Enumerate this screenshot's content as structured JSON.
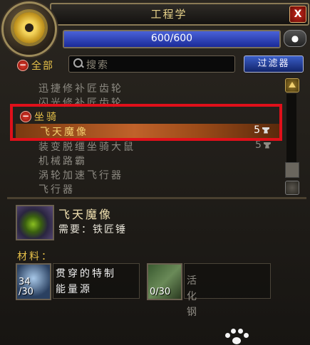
{
  "window": {
    "title": "工程学",
    "close_label": "X"
  },
  "skill": {
    "current": 600,
    "max": 600,
    "text": "600/600",
    "fraction": 1.0
  },
  "chat_button": {
    "label": ""
  },
  "filter_all": {
    "label": "全部"
  },
  "search": {
    "placeholder": "搜索"
  },
  "filter_button": {
    "label": "过滤器"
  },
  "list": {
    "before": [
      {
        "name": "迅捷修补匠齿轮"
      },
      {
        "name": "闪光修补匠齿轮"
      }
    ],
    "category": {
      "name": "坐骑"
    },
    "selected": {
      "name": "飞天魔像",
      "count": "5"
    },
    "after": [
      {
        "name": "装变脱缰坐骑大鼠",
        "count": "5"
      },
      {
        "name": "机械路霸"
      },
      {
        "name": "涡轮加速飞行器"
      },
      {
        "name": "飞行器"
      }
    ]
  },
  "detail": {
    "name": "飞天魔像",
    "requires": "需要：铁匠锤",
    "materials_label": "材料：",
    "materials": [
      {
        "name": "贯穿的特制能量源",
        "count": "34\n/30"
      },
      {
        "name": "活化钢",
        "count": "0/30"
      }
    ]
  },
  "colors": {
    "highlight_border": "#e0101a",
    "selected_row": "#c0622a",
    "category_text": "#e8c24a",
    "skill_bar": "#2a3cb8"
  }
}
